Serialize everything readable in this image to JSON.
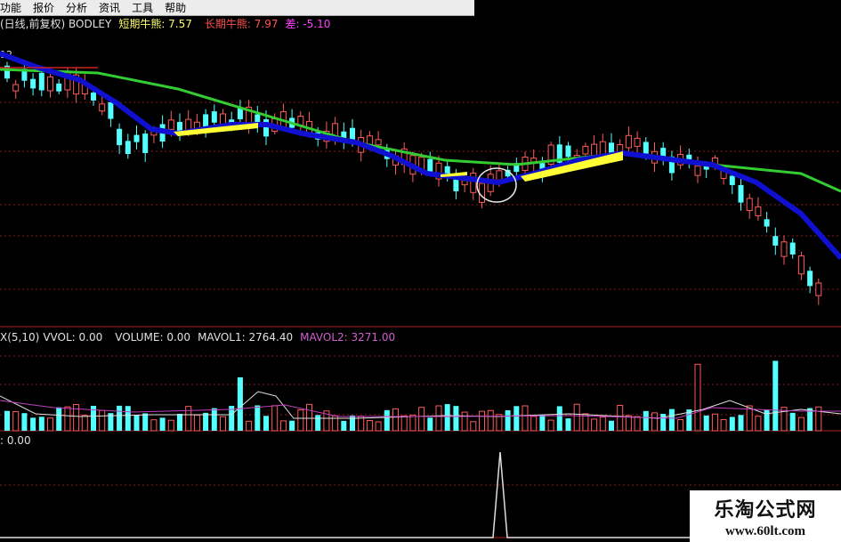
{
  "menu": [
    "功能",
    "报价",
    "分析",
    "资讯",
    "工具",
    "帮助"
  ],
  "main_panel": {
    "title": "(日线,前复权) BODLEY",
    "short_label": "短期牛熊: 7.57",
    "long_label": "长期牛熊: 7.97",
    "diff_label": "差: -5.10",
    "price_tick": "12"
  },
  "volume_panel": {
    "prefix": "X(5,10)",
    "vvol": "VVOL: 0.00",
    "volume": "VOLUME: 0.00",
    "mavol1": "MAVOL1: 2764.40",
    "mavol2": "MAVOL2: 3271.00"
  },
  "signal_panel": {
    "value": ": 0.00"
  },
  "watermark": {
    "name": "乐淘公式网",
    "url": "www.60lt.com"
  },
  "colors": {
    "up": "#ff5a5a",
    "down": "#54ffff",
    "short_line": "#1010d0",
    "long_line": "#33cc33",
    "overlap": "#ffff33",
    "grid": "#8a1a1a",
    "mavol1": "#e0e0e0",
    "mavol2": "#c040c0",
    "volume_title": "#e0e0e0",
    "mavol2_label": "#d060d0",
    "short_label": "#ffff66",
    "long_label": "#ff5050",
    "diff_label": "#ff40ff"
  }
}
